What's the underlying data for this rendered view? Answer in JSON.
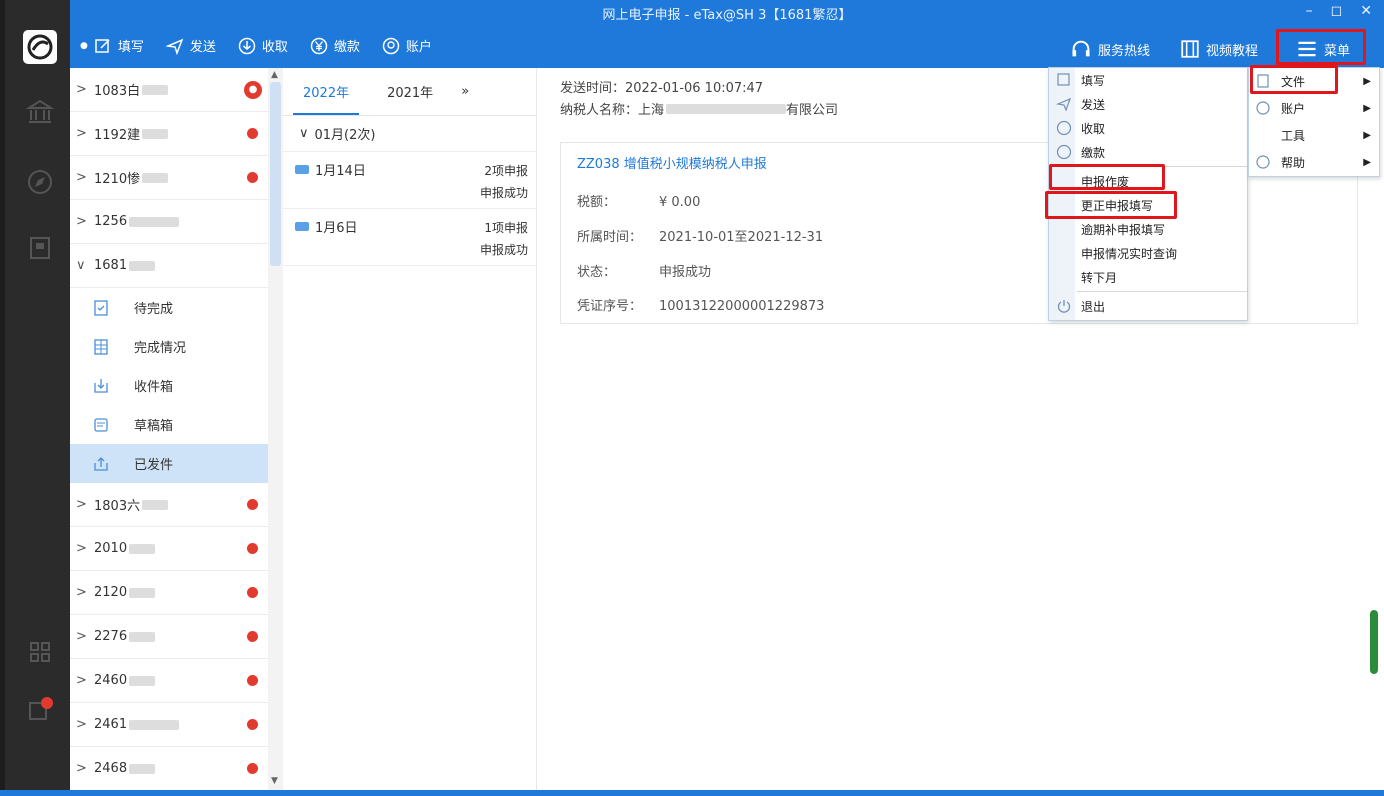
{
  "window": {
    "title": "网上电子申报 - eTax@SH 3【1681繁忍】",
    "controls": [
      "–",
      "◻",
      "✕"
    ]
  },
  "toolbar": {
    "left": [
      {
        "label": "填写",
        "icon": "edit-icon"
      },
      {
        "label": "发送",
        "icon": "send-icon"
      },
      {
        "label": "收取",
        "icon": "download-icon"
      },
      {
        "label": "缴款",
        "icon": "yen-icon"
      },
      {
        "label": "账户",
        "icon": "account-icon"
      }
    ],
    "right": [
      {
        "label": "服务热线",
        "icon": "headset-icon"
      },
      {
        "label": "视频教程",
        "icon": "video-icon"
      },
      {
        "label": "菜单",
        "icon": "menu-icon"
      }
    ]
  },
  "sidebar": {
    "companies_top": [
      {
        "code": "1083白",
        "badge": "big"
      },
      {
        "code": "1192建",
        "badge": "dot"
      },
      {
        "code": "1210惨",
        "badge": "dot"
      },
      {
        "code": "1256",
        "badge": "none"
      }
    ],
    "expanded": {
      "code": "1681",
      "badge": "none"
    },
    "subitems": [
      {
        "label": "待完成",
        "icon": "clipboard-check-icon"
      },
      {
        "label": "完成情况",
        "icon": "table-icon"
      },
      {
        "label": "收件箱",
        "icon": "inbox-icon"
      },
      {
        "label": "草稿箱",
        "icon": "draft-icon"
      },
      {
        "label": "已发件",
        "icon": "outbox-icon",
        "active": true
      }
    ],
    "companies_bottom": [
      {
        "code": "1803六",
        "badge": "dot"
      },
      {
        "code": "2010",
        "badge": "dot"
      },
      {
        "code": "2120",
        "badge": "dot"
      },
      {
        "code": "2276",
        "badge": "dot"
      },
      {
        "code": "2460",
        "badge": "dot"
      },
      {
        "code": "2461",
        "badge": "dot"
      },
      {
        "code": "2468",
        "badge": "dot"
      }
    ]
  },
  "records": {
    "years": [
      "2022年",
      "2021年",
      "»"
    ],
    "month_group": "01月(2次)",
    "items": [
      {
        "date": "1月14日",
        "count": "2项申报",
        "status": "申报成功"
      },
      {
        "date": "1月6日",
        "count": "1项申报",
        "status": "申报成功"
      }
    ]
  },
  "detail": {
    "send_time": "发送时间：2022-01-06 10:07:47",
    "taxpayer": "纳税人名称：上海",
    "taxpayer_suffix": "有限公司",
    "form_title": "ZZ038 增值税小规模纳税人申报",
    "rows": [
      {
        "label": "税额：",
        "value": "¥ 0.00"
      },
      {
        "label": "所属时间：",
        "value": "2021-10-01至2021-12-31"
      },
      {
        "label": "状态：",
        "value": "申报成功"
      },
      {
        "label": "凭证序号：",
        "value": "10013122000001229873"
      }
    ]
  },
  "menu": {
    "items": [
      {
        "label": "填写",
        "icon": "edit-icon"
      },
      {
        "label": "发送",
        "icon": "send-icon"
      },
      {
        "label": "收取",
        "icon": "download-icon"
      },
      {
        "label": "缴款",
        "icon": "yen-icon"
      },
      {
        "label": "申报作废",
        "icon": ""
      },
      {
        "label": "更正申报填写",
        "icon": ""
      },
      {
        "label": "逾期补申报填写",
        "icon": ""
      },
      {
        "label": "申报情况实时查询",
        "icon": ""
      },
      {
        "label": "转下月",
        "icon": ""
      },
      {
        "label": "退出",
        "icon": "power-icon"
      }
    ],
    "submenu": [
      {
        "label": "文件",
        "icon": "file-icon"
      },
      {
        "label": "账户",
        "icon": "account-icon"
      },
      {
        "label": "工具",
        "icon": ""
      },
      {
        "label": "帮助",
        "icon": "help-icon"
      }
    ]
  },
  "colors": {
    "primary": "#1f79db",
    "highlight_box": "#e0171a",
    "badge_red": "#e33a30",
    "active_row": "#cfe3f8"
  }
}
